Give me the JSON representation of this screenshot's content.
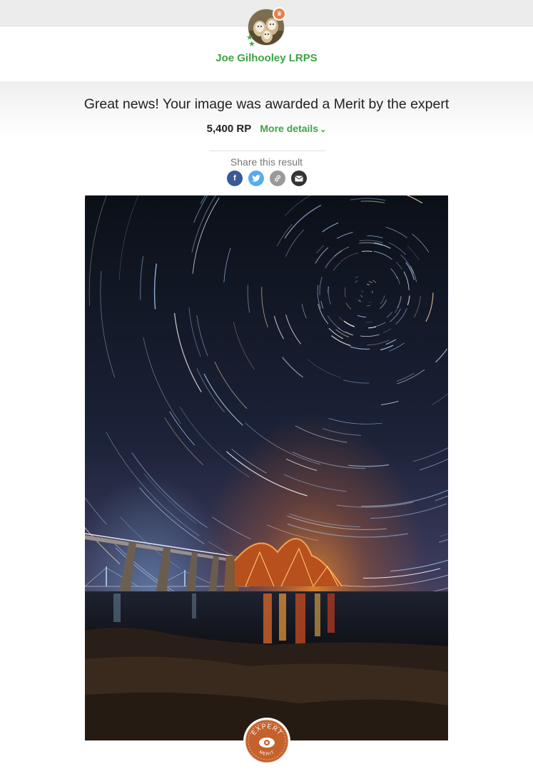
{
  "user": {
    "name": "Joe Gilhooley LRPS"
  },
  "result": {
    "headline": "Great news! Your image was awarded a Merit by the expert",
    "points": "5,400 RP",
    "more_details": "More details"
  },
  "share": {
    "label": "Share this result",
    "icons": [
      "facebook-icon",
      "twitter-icon",
      "link-icon",
      "email-icon"
    ]
  },
  "badge": {
    "top_text": "EXPERT",
    "bottom_text": "MERIT"
  },
  "colors": {
    "accent_green": "#3da544",
    "badge_orange": "#c4622d"
  }
}
